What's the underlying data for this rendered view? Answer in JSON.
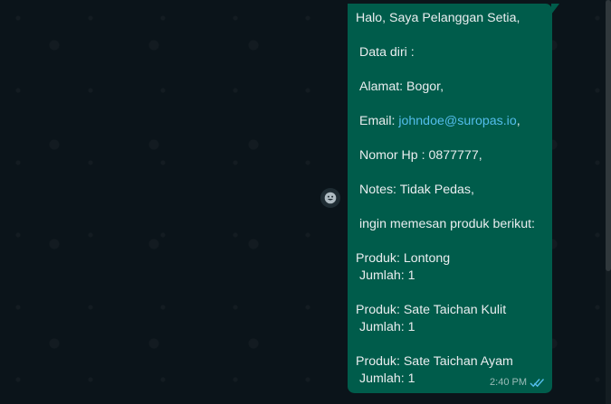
{
  "message": {
    "greeting": "Halo, Saya Pelanggan Setia,",
    "data_diri": "Data diri :",
    "alamat": "Alamat: Bogor,",
    "email_label": "Email: ",
    "email_link": "johndoe@suropas.io",
    "email_suffix": ",",
    "phone": "Nomor Hp : 0877777,",
    "notes": "Notes: Tidak Pedas,",
    "intro_order": "ingin memesan produk berikut:",
    "items": [
      {
        "product": "Produk: Lontong",
        "qty": "Jumlah: 1"
      },
      {
        "product": "Produk: Sate Taichan Kulit",
        "qty": "Jumlah: 1"
      },
      {
        "product": "Produk: Sate Taichan Ayam",
        "qty": "Jumlah: 1"
      }
    ],
    "time": "2:40 PM",
    "status_icon": "double-check-read-icon"
  },
  "colors": {
    "background": "#0b141a",
    "bubble": "#005c4b",
    "text": "#e9edef",
    "link": "#53bdeb",
    "read_ticks": "#53bdeb"
  },
  "icons": {
    "reaction": "smiley-icon"
  }
}
